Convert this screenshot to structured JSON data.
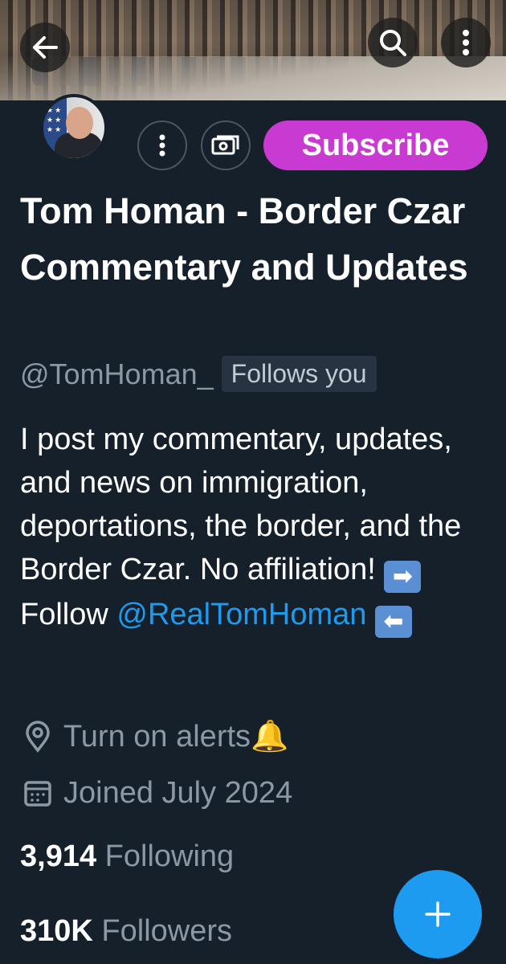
{
  "header": {
    "back_icon": "arrow-left-icon",
    "search_icon": "search-icon",
    "more_icon": "more-vertical-icon"
  },
  "actions": {
    "more_icon": "more-vertical-icon",
    "subscriptions_icon": "money-icon",
    "subscribe_label": "Subscribe",
    "subscribe_color": "#c93ad2"
  },
  "profile": {
    "display_name": "Tom Homan - Border Czar Commentary and Updates",
    "handle": "@TomHoman_",
    "follows_you": "Follows you",
    "bio_text": "I post my commentary, updates, and news on immigration, deportations, the border, and the Border Czar. No affiliation! ",
    "bio_follow_prefix": "Follow ",
    "bio_mention": "@RealTomHoman",
    "right_arrow_emoji": "➡",
    "left_arrow_emoji": "⬅",
    "alerts_text": "Turn on alerts ",
    "bell_emoji": "🔔",
    "joined_text": "Joined July 2024",
    "following_count": "3,914",
    "following_label": "Following",
    "followers_count": "310K",
    "followers_label": "Followers",
    "mention_color": "#1d9bf0"
  },
  "fab": {
    "label": "+",
    "color": "#1d9bf0"
  }
}
